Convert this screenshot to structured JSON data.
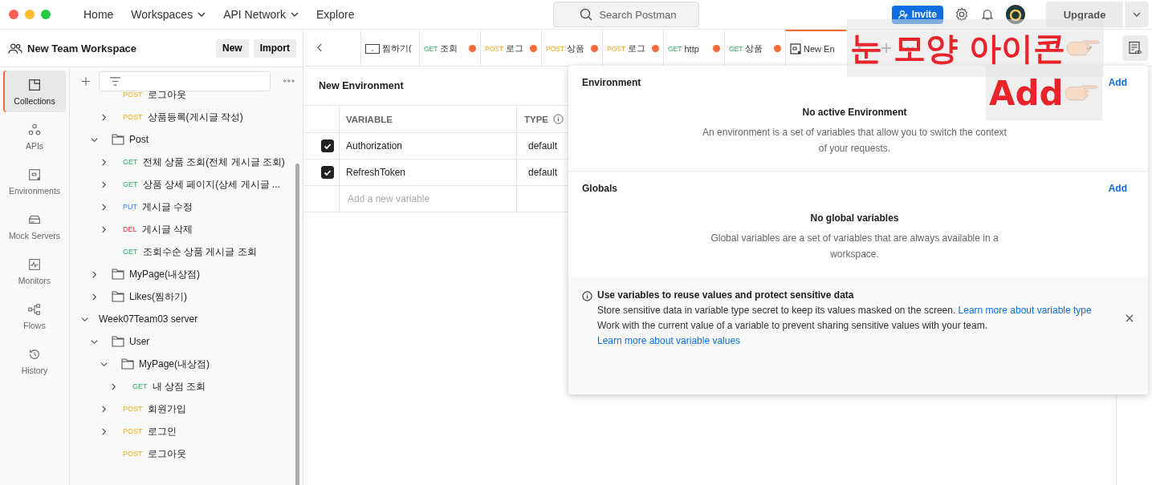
{
  "nav": [
    {
      "label": "Home",
      "dropdown": false
    },
    {
      "label": "Workspaces",
      "dropdown": true
    },
    {
      "label": "API Network",
      "dropdown": true
    },
    {
      "label": "Explore",
      "dropdown": false
    }
  ],
  "search": {
    "placeholder": "Search Postman"
  },
  "invite": "Invite",
  "upgrade": "Upgrade",
  "workspace": {
    "name": "New Team Workspace",
    "buttons": [
      "New",
      "Import"
    ]
  },
  "rail": [
    {
      "label": "Collections",
      "kind": "collections",
      "selected": true
    },
    {
      "label": "APIs",
      "kind": "apis",
      "selected": false
    },
    {
      "label": "Environments",
      "kind": "environments",
      "selected": false
    },
    {
      "label": "Mock Servers",
      "kind": "mock",
      "selected": false
    },
    {
      "label": "Monitors",
      "kind": "monitors",
      "selected": false
    },
    {
      "label": "Flows",
      "kind": "flows",
      "selected": false
    },
    {
      "label": "History",
      "kind": "history",
      "selected": false
    }
  ],
  "tree": [
    {
      "children": [
        {
          "children": [
            {
              "kind": "request",
              "method": "POST",
              "name": "로그아웃"
            },
            {
              "kind": "request",
              "method": "POST",
              "name": "상품등록(게시글 작성)",
              "expanded": false
            }
          ]
        },
        {
          "kind": "folder",
          "name": "Post",
          "expanded": true,
          "children": [
            {
              "kind": "request",
              "method": "GET",
              "name": "전체 상품 조회(전체 게시글 조회)",
              "expanded": false
            },
            {
              "kind": "request",
              "method": "GET",
              "name": "상품 상세 페이지(상세 게시글 ...",
              "expanded": false
            },
            {
              "kind": "request",
              "method": "PUT",
              "name": "게시글 수정",
              "expanded": false
            },
            {
              "kind": "request",
              "method": "DEL",
              "name": "게시글 삭제",
              "expanded": false
            },
            {
              "kind": "request",
              "method": "GET",
              "name": "조회수순 상품 게시글 조회"
            }
          ]
        },
        {
          "kind": "folder",
          "name": "MyPage(내상점)",
          "expanded": false
        },
        {
          "kind": "folder",
          "name": "Likes(찜하기)",
          "expanded": false
        }
      ]
    },
    {
      "kind": "collection",
      "name": "Week07Team03 server",
      "expanded": true,
      "children": [
        {
          "kind": "folder",
          "name": "User",
          "expanded": true,
          "children": [
            {
              "kind": "folder",
              "name": "MyPage(내상점)",
              "expanded": true,
              "children": [
                {
                  "kind": "request",
                  "method": "GET",
                  "name": "내 상점 조회",
                  "expanded": false
                }
              ]
            },
            {
              "kind": "request",
              "method": "POST",
              "name": "회원가입",
              "expanded": false
            },
            {
              "kind": "request",
              "method": "POST",
              "name": "로그인",
              "expanded": false
            },
            {
              "kind": "request",
              "method": "POST",
              "name": "로그아웃"
            }
          ]
        }
      ]
    }
  ],
  "tabs": [
    {
      "kind": "example",
      "label": "찜하기(",
      "unsaved": false,
      "selected": false
    },
    {
      "kind": "request",
      "method": "GET",
      "label": "조회",
      "unsaved": true,
      "selected": false
    },
    {
      "kind": "request",
      "method": "POST",
      "label": "로그",
      "unsaved": true,
      "selected": false
    },
    {
      "kind": "request",
      "method": "POST",
      "label": "상품",
      "unsaved": true,
      "selected": false
    },
    {
      "kind": "request",
      "method": "POST",
      "label": "로그",
      "unsaved": true,
      "selected": false
    },
    {
      "kind": "request",
      "method": "GET",
      "label": "http",
      "unsaved": true,
      "selected": false
    },
    {
      "kind": "request",
      "method": "GET",
      "label": "상품",
      "unsaved": true,
      "selected": false
    },
    {
      "kind": "environment",
      "label": "New En",
      "unsaved": false,
      "selected": true
    }
  ],
  "editor": {
    "title": "New Environment",
    "columns": [
      "VARIABLE",
      "TYPE"
    ],
    "rows": [
      {
        "checked": true,
        "variable": "Authorization",
        "type": "default"
      },
      {
        "checked": true,
        "variable": "RefreshToken",
        "type": "default"
      }
    ],
    "new_row_placeholder": "Add a new variable"
  },
  "popover": {
    "sections": [
      {
        "title": "Environment",
        "action": "Add",
        "empty_title": "No active Environment",
        "empty_text": "An environment is a set of variables that allow you to switch the context of your requests."
      },
      {
        "title": "Globals",
        "action": "Add",
        "empty_title": "No global variables",
        "empty_text": "Global variables are a set of variables that are always available in a workspace."
      }
    ],
    "tip": {
      "title": "Use variables to reuse values and protect sensitive data",
      "lines": [
        {
          "text": "Store sensitive data in variable type secret to keep its values masked on the screen.",
          "link": "Learn more about variable type"
        },
        {
          "text": "Work with the current value of a variable to prevent sharing sensitive values with your team.",
          "link": "Learn more about variable values"
        }
      ]
    }
  },
  "annotations": [
    {
      "text": "눈 모양 아이콘"
    },
    {
      "text": "Add"
    }
  ]
}
